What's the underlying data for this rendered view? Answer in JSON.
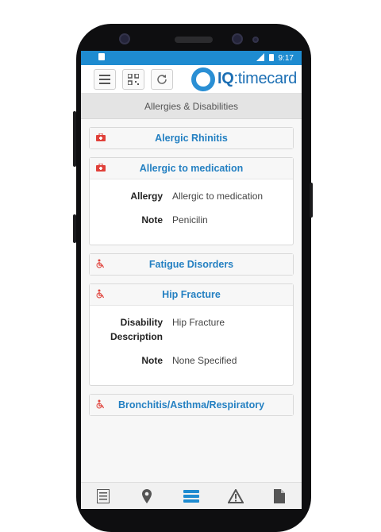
{
  "status_bar": {
    "time": "9:17"
  },
  "header": {
    "logo_prefix": "IQ",
    "logo_suffix": ":timecard"
  },
  "subheader": {
    "title": "Allergies & Disabilities"
  },
  "cards": [
    {
      "title": "Alergic Rhinitis",
      "icon": "first-aid-kit-icon"
    },
    {
      "title": "Allergic to medication",
      "icon": "medical-case-icon",
      "fields": [
        {
          "label": "Allergy",
          "value": "Allergic to medication"
        },
        {
          "label": "Note",
          "value": "Penicilin"
        }
      ]
    },
    {
      "title": "Fatigue Disorders",
      "icon": "wheelchair-icon"
    },
    {
      "title": "Hip Fracture",
      "icon": "wheelchair-icon",
      "fields": [
        {
          "label": "Disability Description",
          "value": "Hip Fracture"
        },
        {
          "label": "Note",
          "value": "None Specified"
        }
      ]
    },
    {
      "title": "Bronchitis/Asthma/Respiratory",
      "icon": "wheelchair-icon"
    }
  ],
  "bottom_nav": [
    "list-icon",
    "location-pin-icon",
    "server-stack-icon",
    "warning-icon",
    "document-icon"
  ],
  "colors": {
    "status_bar": "#1e8bd0",
    "card_title": "#2480c2",
    "icon_red": "#e0413a",
    "active_nav": "#1e8bd0"
  }
}
